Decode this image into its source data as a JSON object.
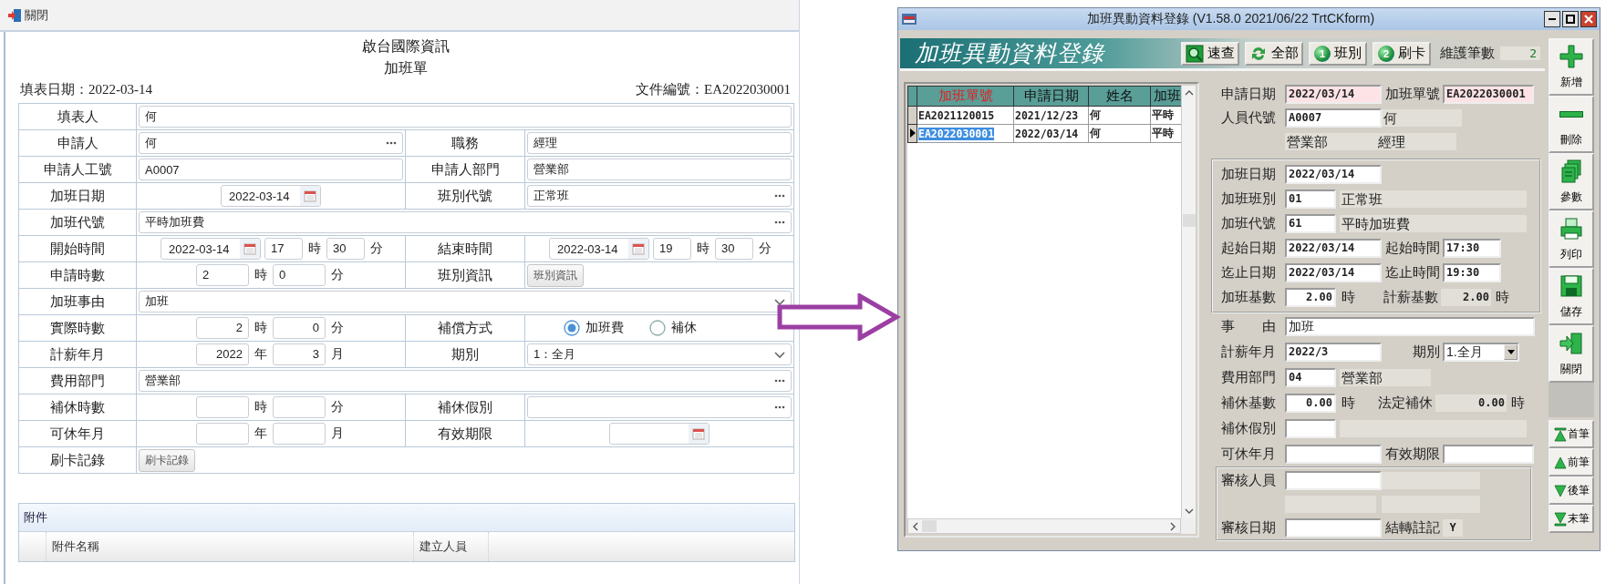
{
  "web_form": {
    "toolbar": {
      "close": "關閉"
    },
    "company": "啟台國際資訊",
    "title": "加班單",
    "fill_date": "填表日期：2022-03-14",
    "doc_number": "文件編號：EA2022030001",
    "rows": [
      [
        {
          "label": "填表人",
          "kind": "text",
          "value": "何"
        }
      ],
      [
        {
          "label": "申請人",
          "kind": "picker",
          "value": "何"
        },
        {
          "label": "職務",
          "kind": "text",
          "value": "經理"
        }
      ],
      [
        {
          "label": "申請人工號",
          "kind": "text",
          "value": "A0007"
        },
        {
          "label": "申請人部門",
          "kind": "text",
          "value": "營業部"
        }
      ],
      [
        {
          "label": "加班日期",
          "kind": "date",
          "value": "2022-03-14"
        },
        {
          "label": "班別代號",
          "kind": "picker",
          "value": "正常班"
        }
      ],
      [
        {
          "label": "加班代號",
          "kind": "picker",
          "value": "平時加班費"
        }
      ],
      [
        {
          "label": "開始時間",
          "kind": "datetime",
          "value": "2022-03-14",
          "first": "17",
          "first_unit": "時",
          "second": "30",
          "second_unit": "分"
        },
        {
          "label": "結束時間",
          "kind": "datetime",
          "value": "2022-03-14",
          "first": "19",
          "first_unit": "時",
          "second": "30",
          "second_unit": "分"
        }
      ],
      [
        {
          "label": "申請時數",
          "kind": "pair",
          "first": "2",
          "first_unit": "時",
          "second": "0",
          "second_unit": "分",
          "numeric": false
        },
        {
          "label": "班別資訊",
          "kind": "button",
          "value": "班別資訊"
        }
      ],
      [
        {
          "label": "加班事由",
          "kind": "select",
          "value": "加班"
        }
      ],
      [
        {
          "label": "實際時數",
          "kind": "pair",
          "first": "2",
          "first_unit": "時",
          "second": "0",
          "second_unit": "分",
          "numeric": true
        },
        {
          "label": "補償方式",
          "kind": "radio",
          "options": [
            {
              "label": "加班費",
              "selected": true
            },
            {
              "label": "補休",
              "selected": false
            }
          ]
        }
      ],
      [
        {
          "label": "計薪年月",
          "kind": "pair",
          "first": "2022",
          "first_unit": "年",
          "second": "3",
          "second_unit": "月",
          "numeric": true
        },
        {
          "label": "期別",
          "kind": "select",
          "value": "1：全月"
        }
      ],
      [
        {
          "label": "費用部門",
          "kind": "picker",
          "value": "營業部"
        }
      ],
      [
        {
          "label": "補休時數",
          "kind": "pair",
          "first_unit": "時",
          "second_unit": "分"
        },
        {
          "label": "補休假別",
          "kind": "picker"
        }
      ],
      [
        {
          "label": "可休年月",
          "kind": "pair",
          "first_unit": "年",
          "second_unit": "月"
        },
        {
          "label": "有效期限",
          "kind": "date"
        }
      ],
      [
        {
          "label": "刷卡記錄",
          "kind": "button",
          "value": "刷卡記錄"
        }
      ]
    ],
    "attachments": {
      "title": "附件",
      "columns": [
        "附件名稱",
        "建立人員"
      ]
    }
  },
  "app_window": {
    "title": "加班異動資料登錄 (V1.58.0 2021/06/22 TrtCKform)",
    "banner": "加班異動資料登錄",
    "tools": [
      {
        "label": "速查",
        "kind": "search"
      },
      {
        "label": "全部",
        "kind": "all"
      },
      {
        "label": "班別",
        "kind": "numbered",
        "number": "1"
      },
      {
        "label": "刷卡",
        "kind": "numbered",
        "number": "2"
      }
    ],
    "count_label": "維護筆數",
    "count": "2",
    "grid": {
      "columns": [
        {
          "label": "加班單號",
          "sorted": true
        },
        {
          "label": "申請日期",
          "sorted": false
        },
        {
          "label": "姓名",
          "sorted": false
        },
        {
          "label": "加班",
          "sorted": false
        }
      ],
      "rows": [
        {
          "cells": [
            "EA2021120015",
            "2021/12/23",
            "何",
            "平時"
          ],
          "selected": false
        },
        {
          "cells": [
            "EA2022030001",
            "2022/03/14",
            "何",
            "平時"
          ],
          "selected": true
        }
      ]
    },
    "header_rows": [
      {
        "left": [
          {
            "kind": "label",
            "text": "申請日期"
          },
          {
            "kind": "field",
            "value": "2022/03/14",
            "highlighted": true
          }
        ],
        "right": [
          {
            "kind": "label",
            "text": "加班單號"
          },
          {
            "kind": "field",
            "value": "EA2022030001",
            "highlighted": true
          }
        ]
      },
      {
        "left": [
          {
            "kind": "label",
            "text": "人員代號"
          },
          {
            "kind": "field",
            "value": "A0007",
            "highlighted": false
          }
        ],
        "right": [
          {
            "kind": "readout",
            "text": "何"
          }
        ]
      },
      {
        "left": [
          {
            "kind": "readout",
            "text": "營業部"
          }
        ],
        "right": [
          {
            "kind": "readout",
            "text": "經理"
          }
        ]
      }
    ],
    "detail_group": [
      {
        "left": [
          {
            "kind": "label",
            "text": "加班日期"
          },
          {
            "kind": "field",
            "value": "2022/03/14",
            "highlighted": false
          }
        ]
      },
      {
        "left": [
          {
            "kind": "label",
            "text": "加班班別"
          },
          {
            "kind": "short_field",
            "value": "01",
            "highlighted": false
          },
          {
            "kind": "long_readout",
            "text": "正常班"
          }
        ]
      },
      {
        "left": [
          {
            "kind": "label",
            "text": "加班代號"
          },
          {
            "kind": "short_field",
            "value": "61",
            "highlighted": false
          },
          {
            "kind": "long_readout",
            "text": "平時加班費"
          }
        ]
      },
      {
        "left": [
          {
            "kind": "label",
            "text": "起始日期"
          },
          {
            "kind": "field",
            "value": "2022/03/14",
            "highlighted": false
          }
        ],
        "right": [
          {
            "kind": "label",
            "text": "起始時間"
          },
          {
            "kind": "time_field",
            "value": "17:30",
            "highlighted": false
          }
        ]
      },
      {
        "left": [
          {
            "kind": "label",
            "text": "迄止日期"
          },
          {
            "kind": "field",
            "value": "2022/03/14",
            "highlighted": false
          }
        ],
        "right": [
          {
            "kind": "label",
            "text": "迄止時間"
          },
          {
            "kind": "time_field",
            "value": "19:30",
            "highlighted": false
          }
        ]
      },
      {
        "left": [
          {
            "kind": "label",
            "text": "加班基數"
          },
          {
            "kind": "number_field",
            "value": "2.00",
            "highlighted": false
          },
          {
            "kind": "unit",
            "text": "時"
          }
        ],
        "right": [
          {
            "kind": "label",
            "text": "計薪基數"
          },
          {
            "kind": "number_readout",
            "text": "2.00"
          },
          {
            "kind": "unit",
            "text": "時"
          }
        ]
      }
    ],
    "lower_rows": [
      {
        "left": [
          {
            "kind": "label",
            "text": "事　　由"
          },
          {
            "kind": "wide_field",
            "value": "加班",
            "highlighted": false
          }
        ]
      },
      {
        "left": [
          {
            "kind": "label",
            "text": "計薪年月"
          },
          {
            "kind": "field",
            "value": "2022/3",
            "highlighted": false
          }
        ],
        "right": [
          {
            "kind": "label",
            "text": "期別"
          },
          {
            "kind": "dropdown",
            "value": "1.全月"
          }
        ]
      },
      {
        "left": [
          {
            "kind": "label",
            "text": "費用部門"
          },
          {
            "kind": "short_field",
            "value": "04",
            "highlighted": false
          },
          {
            "kind": "readout",
            "text": "營業部"
          }
        ]
      },
      {
        "left": [
          {
            "kind": "label",
            "text": "補休基數"
          },
          {
            "kind": "number_field",
            "value": "0.00",
            "highlighted": false
          },
          {
            "kind": "unit",
            "text": "時"
          }
        ],
        "right": [
          {
            "kind": "label",
            "text": "法定補休"
          },
          {
            "kind": "wide_number_readout",
            "text": "0.00"
          },
          {
            "kind": "unit",
            "text": "時"
          }
        ]
      },
      {
        "left": [
          {
            "kind": "label",
            "text": "補休假別"
          },
          {
            "kind": "short_field",
            "highlighted": false
          },
          {
            "kind": "long_readout"
          }
        ]
      },
      {
        "left": [
          {
            "kind": "label",
            "text": "可休年月"
          },
          {
            "kind": "field",
            "highlighted": false
          }
        ],
        "right": [
          {
            "kind": "label",
            "text": "有效期限"
          },
          {
            "kind": "field",
            "highlighted": false
          }
        ]
      }
    ],
    "review_group": [
      {
        "left": [
          {
            "kind": "label",
            "text": "審核人員"
          },
          {
            "kind": "field",
            "highlighted": false
          }
        ],
        "right": [
          {
            "kind": "readout"
          }
        ]
      },
      {
        "left": [
          {
            "kind": "readout"
          }
        ],
        "right": [
          {
            "kind": "readout"
          }
        ]
      },
      {
        "left": [
          {
            "kind": "label",
            "text": "審核日期"
          },
          {
            "kind": "field",
            "highlighted": false
          }
        ],
        "right": [
          {
            "kind": "label",
            "text": "結轉註記"
          },
          {
            "kind": "small_readout",
            "text": "Y"
          }
        ]
      }
    ],
    "actions": [
      {
        "label": "新增",
        "kind": "add"
      },
      {
        "label": "刪除",
        "kind": "delete"
      },
      {
        "label": "參數",
        "kind": "params"
      },
      {
        "label": "列印",
        "kind": "print"
      },
      {
        "label": "儲存",
        "kind": "save"
      },
      {
        "label": "關閉",
        "kind": "exit"
      }
    ],
    "navigation": [
      {
        "label": "首筆",
        "kind": "first"
      },
      {
        "label": "前筆",
        "kind": "prev"
      },
      {
        "label": "後筆",
        "kind": "next"
      },
      {
        "label": "末筆",
        "kind": "last"
      }
    ]
  }
}
